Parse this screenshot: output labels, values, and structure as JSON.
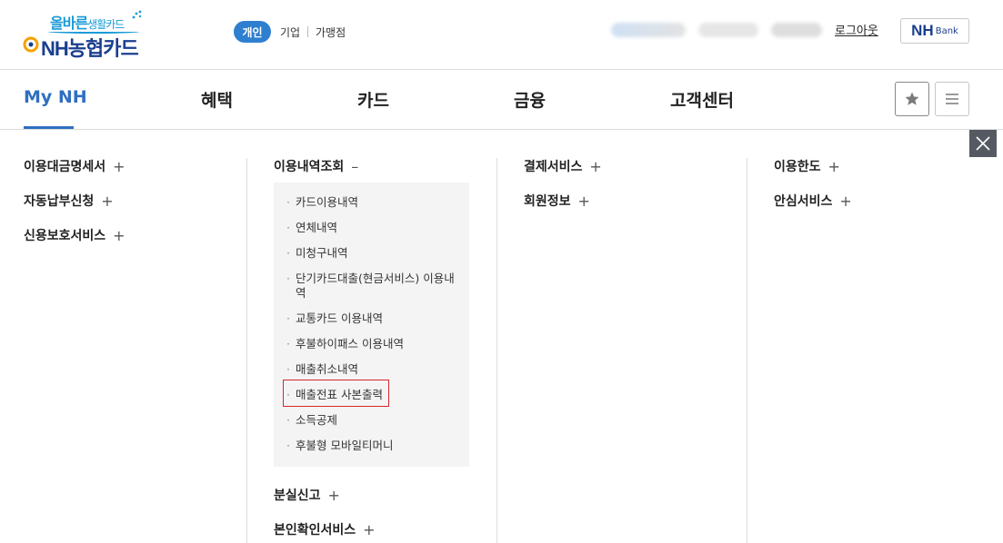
{
  "header": {
    "logo_top_bold": "올바른",
    "logo_top_light": "생활카드",
    "logo_main": "NH농협카드",
    "segments": {
      "personal": "개인",
      "business": "기업",
      "merchant": "가맹점"
    },
    "logout": "로그아웃",
    "bank_nh": "NH",
    "bank_label": "Bank"
  },
  "gnb": {
    "items": [
      "My NH",
      "혜택",
      "카드",
      "금융",
      "고객센터"
    ],
    "icons": {
      "favorite": "star-icon",
      "menu": "hamburger-icon",
      "close": "close-icon"
    }
  },
  "menu": {
    "col1": [
      {
        "label": "이용대금명세서",
        "sign": "+"
      },
      {
        "label": "자동납부신청",
        "sign": "+"
      },
      {
        "label": "신용보호서비스",
        "sign": "+"
      }
    ],
    "col2": {
      "expanded": {
        "label": "이용내역조회",
        "sign": "–"
      },
      "sub_items": [
        "카드이용내역",
        "연체내역",
        "미청구내역",
        "단기카드대출(현금서비스) 이용내역",
        "교통카드 이용내역",
        "후불하이패스 이용내역",
        "매출취소내역",
        "매출전표 사본출력",
        "소득공제",
        "후불형 모바일티머니"
      ],
      "highlighted_index": 7,
      "after": [
        {
          "label": "분실신고",
          "sign": "+"
        },
        {
          "label": "본인확인서비스",
          "sign": "+"
        }
      ]
    },
    "col3": [
      {
        "label": "결제서비스",
        "sign": "+"
      },
      {
        "label": "회원정보",
        "sign": "+"
      }
    ],
    "col4": [
      {
        "label": "이용한도",
        "sign": "+"
      },
      {
        "label": "안심서비스",
        "sign": "+"
      }
    ]
  },
  "colors": {
    "accent": "#2f6fc0",
    "badge": "#2f7fd0",
    "highlight_border": "#d8262c",
    "submenu_bg": "#f4f4f4"
  }
}
